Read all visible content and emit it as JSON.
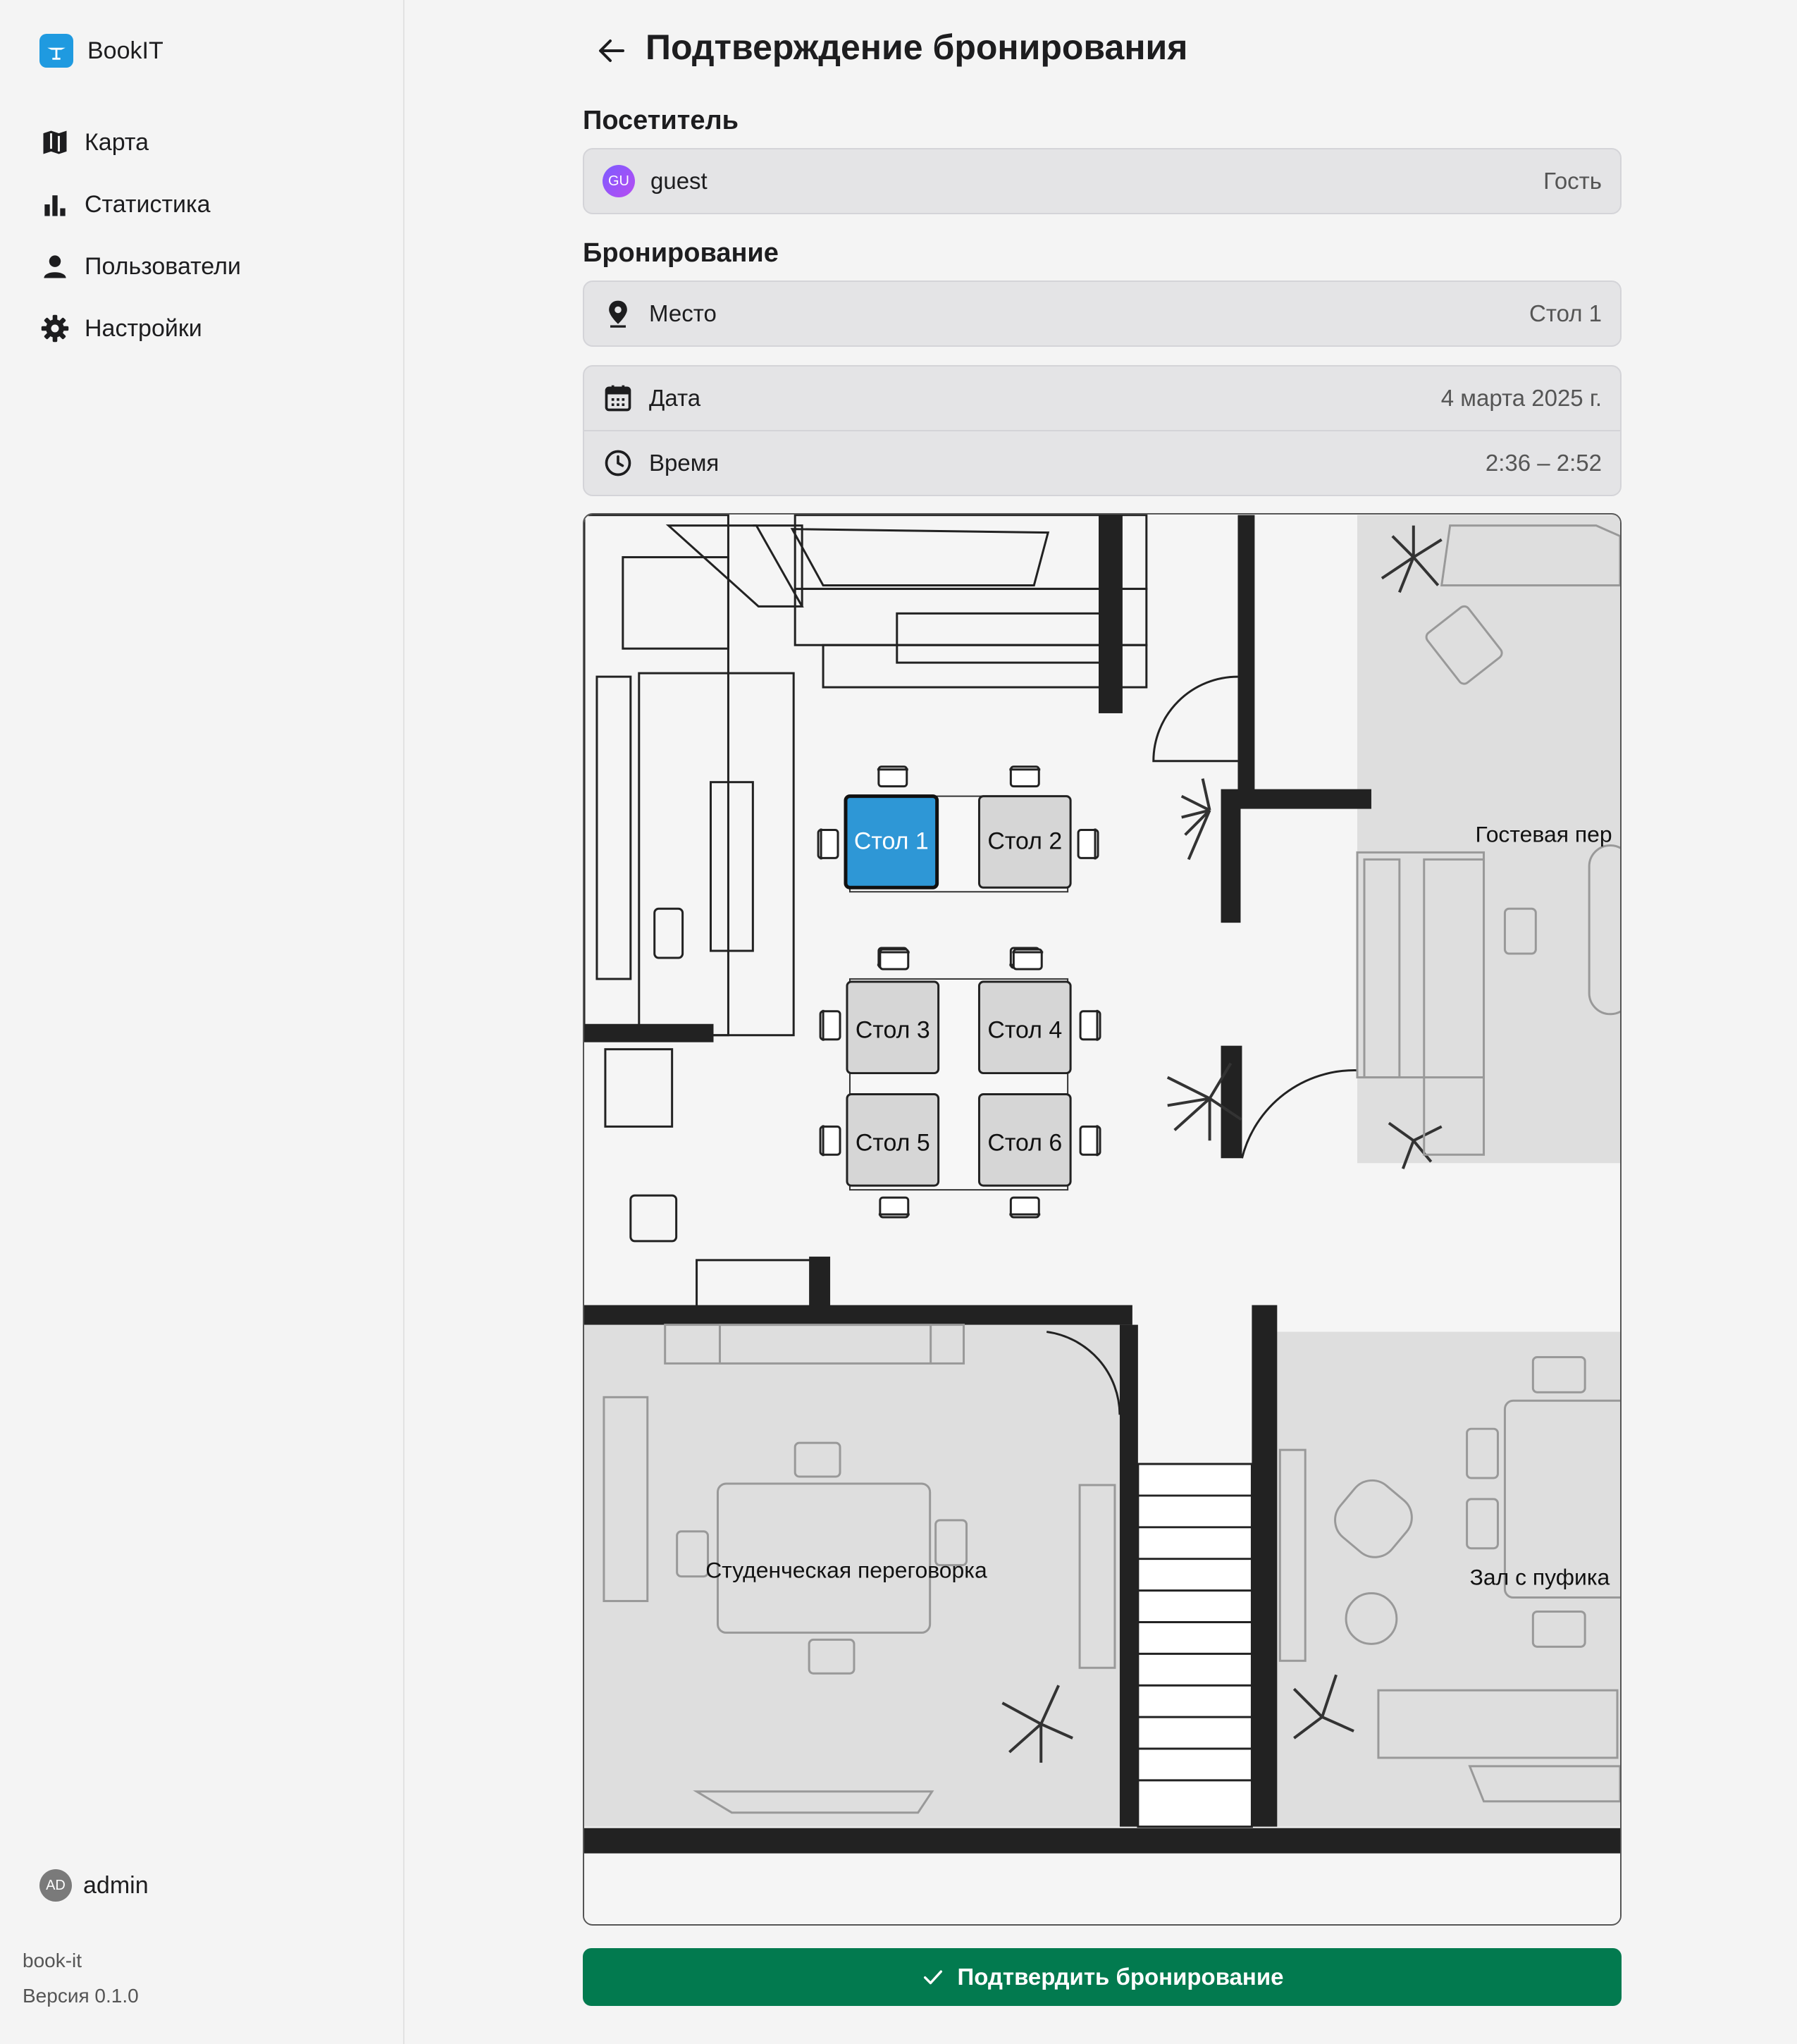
{
  "app": {
    "name": "BookIT",
    "id": "book-it",
    "version": "Версия 0.1.0"
  },
  "sidebar": {
    "items": [
      {
        "label": "Карта",
        "icon": "map-icon"
      },
      {
        "label": "Статистика",
        "icon": "bar-chart-icon"
      },
      {
        "label": "Пользователи",
        "icon": "user-icon"
      },
      {
        "label": "Настройки",
        "icon": "gear-icon"
      }
    ],
    "user": {
      "initials": "AD",
      "name": "admin"
    }
  },
  "page": {
    "title": "Подтверждение бронирования"
  },
  "visitor": {
    "section_label": "Посетитель",
    "initials": "GU",
    "name": "guest",
    "role": "Гость"
  },
  "booking": {
    "section_label": "Бронирование",
    "place": {
      "label": "Место",
      "value": "Стол 1"
    },
    "date": {
      "label": "Дата",
      "value": "4 марта 2025 г."
    },
    "time": {
      "label": "Время",
      "value": "2:36 – 2:52"
    }
  },
  "map": {
    "selected_desk": "Стол 1",
    "desks": [
      "Стол 1",
      "Стол 2",
      "Стол 3",
      "Стол 4",
      "Стол 5",
      "Стол 6"
    ],
    "rooms": [
      "Гостевая пер",
      "Студенческая переговорка",
      "Зал с пуфика"
    ]
  },
  "confirm_button": {
    "label": "Подтвердить бронирование"
  },
  "colors": {
    "brand": "#1f9ae0",
    "confirm": "#027a4f",
    "selected_desk": "#2e97d6"
  }
}
